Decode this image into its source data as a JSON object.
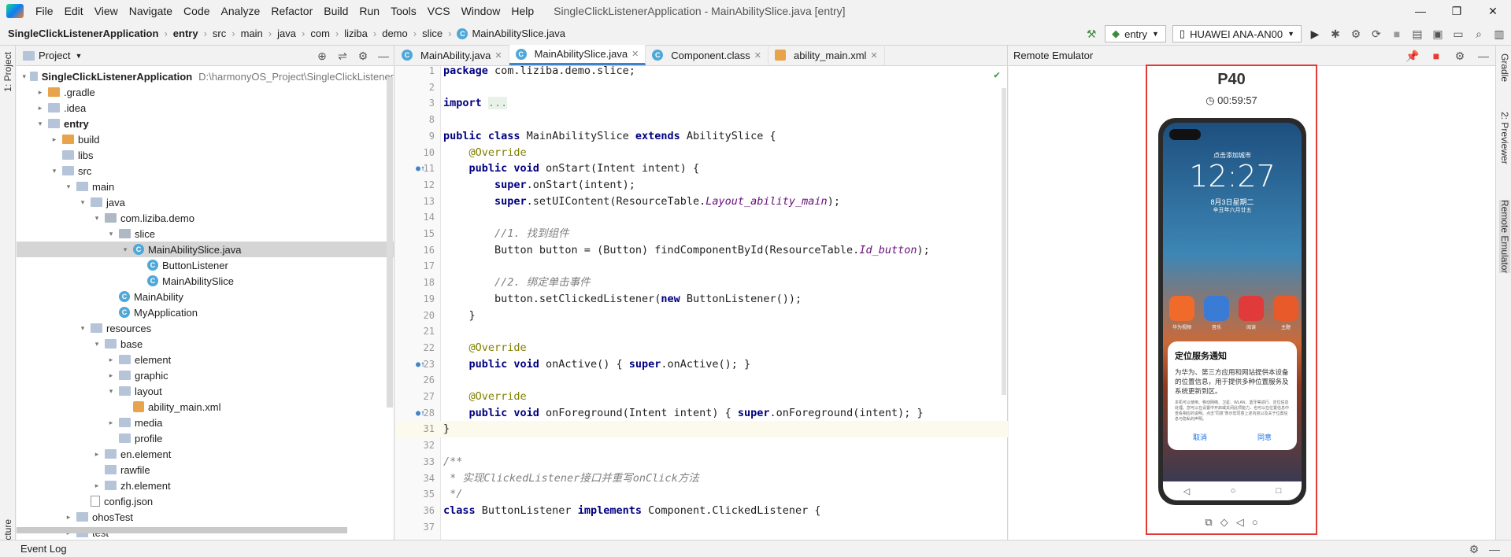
{
  "menubar": {
    "items": [
      "File",
      "Edit",
      "View",
      "Navigate",
      "Code",
      "Analyze",
      "Refactor",
      "Build",
      "Run",
      "Tools",
      "VCS",
      "Window",
      "Help"
    ],
    "window_title": "SingleClickListenerApplication - MainAbilitySlice.java [entry]",
    "minimize": "—",
    "maximize": "❐",
    "close": "✕"
  },
  "breadcrumb": {
    "items": [
      "SingleClickListenerApplication",
      "entry",
      "src",
      "main",
      "java",
      "com",
      "liziba",
      "demo",
      "slice",
      "MainAbilitySlice.java"
    ]
  },
  "runbar": {
    "config": "entry",
    "device": "HUAWEI ANA-AN00"
  },
  "left_stripe": {
    "project_label": "1: Project",
    "structure_label": "Structure"
  },
  "right_stripe": {
    "gradle": "Gradle",
    "previewer": "2: Previewer",
    "emulator": "Remote Emulator"
  },
  "project_panel": {
    "title": "Project",
    "tree": [
      {
        "depth": 0,
        "arrow": "▾",
        "icon": "folder",
        "label": "SingleClickListenerApplication",
        "path": "D:\\harmonyOS_Project\\SingleClickListener",
        "bold": true
      },
      {
        "depth": 1,
        "arrow": "▸",
        "icon": "folder-orange",
        "label": ".gradle"
      },
      {
        "depth": 1,
        "arrow": "▸",
        "icon": "folder",
        "label": ".idea"
      },
      {
        "depth": 1,
        "arrow": "▾",
        "icon": "folder",
        "label": "entry",
        "bold": true
      },
      {
        "depth": 2,
        "arrow": "▸",
        "icon": "folder-orange",
        "label": "build"
      },
      {
        "depth": 2,
        "arrow": "",
        "icon": "folder",
        "label": "libs"
      },
      {
        "depth": 2,
        "arrow": "▾",
        "icon": "folder",
        "label": "src"
      },
      {
        "depth": 3,
        "arrow": "▾",
        "icon": "folder",
        "label": "main"
      },
      {
        "depth": 4,
        "arrow": "▾",
        "icon": "folder",
        "label": "java"
      },
      {
        "depth": 5,
        "arrow": "▾",
        "icon": "folder-gray",
        "label": "com.liziba.demo"
      },
      {
        "depth": 6,
        "arrow": "▾",
        "icon": "folder-gray",
        "label": "slice"
      },
      {
        "depth": 7,
        "arrow": "▾",
        "icon": "class",
        "label": "MainAbilitySlice.java",
        "selected": true
      },
      {
        "depth": 8,
        "arrow": "",
        "icon": "class",
        "label": "ButtonListener"
      },
      {
        "depth": 8,
        "arrow": "",
        "icon": "class",
        "label": "MainAbilitySlice"
      },
      {
        "depth": 6,
        "arrow": "",
        "icon": "class",
        "label": "MainAbility"
      },
      {
        "depth": 6,
        "arrow": "",
        "icon": "class",
        "label": "MyApplication"
      },
      {
        "depth": 4,
        "arrow": "▾",
        "icon": "folder",
        "label": "resources"
      },
      {
        "depth": 5,
        "arrow": "▾",
        "icon": "folder",
        "label": "base"
      },
      {
        "depth": 6,
        "arrow": "▸",
        "icon": "folder",
        "label": "element"
      },
      {
        "depth": 6,
        "arrow": "▸",
        "icon": "folder",
        "label": "graphic"
      },
      {
        "depth": 6,
        "arrow": "▾",
        "icon": "folder",
        "label": "layout"
      },
      {
        "depth": 7,
        "arrow": "",
        "icon": "xml",
        "label": "ability_main.xml"
      },
      {
        "depth": 6,
        "arrow": "▸",
        "icon": "folder",
        "label": "media"
      },
      {
        "depth": 6,
        "arrow": "",
        "icon": "folder",
        "label": "profile"
      },
      {
        "depth": 5,
        "arrow": "▸",
        "icon": "folder",
        "label": "en.element"
      },
      {
        "depth": 5,
        "arrow": "",
        "icon": "folder",
        "label": "rawfile"
      },
      {
        "depth": 5,
        "arrow": "▸",
        "icon": "folder",
        "label": "zh.element"
      },
      {
        "depth": 4,
        "arrow": "",
        "icon": "file",
        "label": "config.json"
      },
      {
        "depth": 3,
        "arrow": "▸",
        "icon": "folder",
        "label": "ohosTest"
      },
      {
        "depth": 3,
        "arrow": "▸",
        "icon": "folder",
        "label": "test"
      }
    ]
  },
  "editor": {
    "tabs": [
      {
        "label": "MainAbility.java",
        "icon": "class",
        "active": false
      },
      {
        "label": "MainAbilitySlice.java",
        "icon": "class",
        "active": true
      },
      {
        "label": "Component.class",
        "icon": "class",
        "active": false
      },
      {
        "label": "ability_main.xml",
        "icon": "xml",
        "active": false
      }
    ],
    "lines": [
      {
        "n": "1",
        "html": "<span class=\"kw\">package</span> com.liziba.demo.slice;"
      },
      {
        "n": "2",
        "html": ""
      },
      {
        "n": "3",
        "html": "<span class=\"kw\">import</span> <span style=\"color:#888;background:#e8f2e8\">...</span>"
      },
      {
        "n": "8",
        "html": ""
      },
      {
        "n": "9",
        "html": "<span class=\"kw\">public class</span> MainAbilitySlice <span class=\"kw\">extends</span> AbilitySlice {"
      },
      {
        "n": "10",
        "html": "    <span class=\"an\">@Override</span>"
      },
      {
        "n": "11",
        "html": "    <span class=\"kw\">public void</span> onStart(Intent intent) {",
        "mark": true
      },
      {
        "n": "12",
        "html": "        <span class=\"kw\">super</span>.onStart(intent);"
      },
      {
        "n": "13",
        "html": "        <span class=\"kw\">super</span>.setUIContent(ResourceTable.<span class=\"it\">Layout_ability_main</span>);"
      },
      {
        "n": "14",
        "html": ""
      },
      {
        "n": "15",
        "html": "        <span class=\"cm\">//1. 找到组件</span>"
      },
      {
        "n": "16",
        "html": "        Button button = (Button) findComponentById(ResourceTable.<span class=\"it\">Id_button</span>);"
      },
      {
        "n": "17",
        "html": ""
      },
      {
        "n": "18",
        "html": "        <span class=\"cm\">//2. 绑定单击事件</span>"
      },
      {
        "n": "19",
        "html": "        button.setClickedListener(<span class=\"kw\">new</span> ButtonListener());"
      },
      {
        "n": "20",
        "html": "    }"
      },
      {
        "n": "21",
        "html": ""
      },
      {
        "n": "22",
        "html": "    <span class=\"an\">@Override</span>"
      },
      {
        "n": "23",
        "html": "    <span class=\"kw\">public void</span> onActive() { <span class=\"kw\">super</span>.onActive(); }",
        "mark": true
      },
      {
        "n": "26",
        "html": ""
      },
      {
        "n": "27",
        "html": "    <span class=\"an\">@Override</span>"
      },
      {
        "n": "28",
        "html": "    <span class=\"kw\">public void</span> onForeground(Intent intent) { <span class=\"kw\">super</span>.onForeground(intent); }",
        "mark": true
      },
      {
        "n": "31",
        "html": "}",
        "current": true
      },
      {
        "n": "32",
        "html": ""
      },
      {
        "n": "33",
        "html": "<span class=\"cm\">/**</span>"
      },
      {
        "n": "34",
        "html": "<span class=\"cm\"> * 实现ClickedListener接口并重写onClick方法</span>"
      },
      {
        "n": "35",
        "html": "<span class=\"cm\"> */</span>"
      },
      {
        "n": "36",
        "html": "<span class=\"kw\">class</span> ButtonListener <span class=\"kw\">implements</span> Component.ClickedListener {"
      },
      {
        "n": "37",
        "html": ""
      }
    ],
    "check_mark": "✔"
  },
  "emulator": {
    "title": "Remote Emulator",
    "device_name": "P40",
    "timer": "00:59:57",
    "lock_top": "点击添加城市",
    "clock": "12:27",
    "date": "8月3日星期二",
    "lunar": "辛丑年六月廿五",
    "apps": [
      "华为视频",
      "音乐",
      "阅读",
      "主题"
    ],
    "dialog": {
      "title": "定位服务通知",
      "body": "为华为、第三方应用和网站提供本设备的位置信息，用于提供多种位置服务及系统更新到区。",
      "small": "本机可以使用、移动网络、卫星、WLAN、蓝牙等进行、定位信息处理。您可以在设置中开启或关闭此项能力，也可以在位置信息中查看相应的说明。点击\"同意\"表示您同意上述内容以及关于位置信息与隐私的声明。",
      "cancel": "取消",
      "agree": "同意"
    },
    "nav": [
      "◁",
      "○",
      "□"
    ],
    "tools": [
      "⧉",
      "◇",
      "◁",
      "○"
    ]
  },
  "bottombar": {
    "event_log": "Event Log"
  }
}
